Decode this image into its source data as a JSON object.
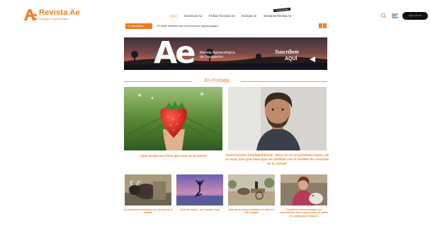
{
  "brand": {
    "name": "Revista Ae",
    "tagline": "Divulgación Agroecológica",
    "accent": "#f07c1f"
  },
  "nav": {
    "items": [
      "Inicio",
      "Secciones Ae",
      "Fichas Técnicas Ae",
      "Noticias Ae",
      "Sumarios Revista Ae"
    ],
    "badge": "¡Ya disponible!",
    "cta": "Agenda Ae"
  },
  "ticker": {
    "label": "Novedades",
    "text": "El cartel definitivo del VIII Encuentro Agroecológico"
  },
  "banner": {
    "logo": "Ae",
    "line1": "Revista Agroecológica",
    "line2": "de Divulgación",
    "cta_top": "Suscríbete",
    "cta_bottom": "AQUÍ"
  },
  "section": {
    "title": "En Portada"
  },
  "featured": [
    {
      "caption": "¿Qué oculta esa fresa que está en tu mesa?",
      "image": "strawberry-photo"
    },
    {
      "caption": "Santi Donaire (Valdepeñalista): \"Esto no es un problema lejano, de lo rural, sino que tiene que ver también con el modelo de consumo en la ciudad\"",
      "image": "portrait-photo"
    }
  ],
  "secondary": [
    {
      "caption": "Las tradiciones colectivas con un manual de cambio",
      "image": "goat-photo"
    },
    {
      "caption": "\"Culto al cuerpo\", por Gustavo Duch",
      "image": "yoga-sunset-photo"
    },
    {
      "caption": "Mirando la tracción animal en el valle del Río Senegal",
      "image": "donkey-cart-photo"
    },
    {
      "caption": "\"Dejaba el control ecológico por conversación. Nos ó otra es hacer el cultivo de semilla para el pulgón\"",
      "image": "woman-dog-photo"
    }
  ]
}
